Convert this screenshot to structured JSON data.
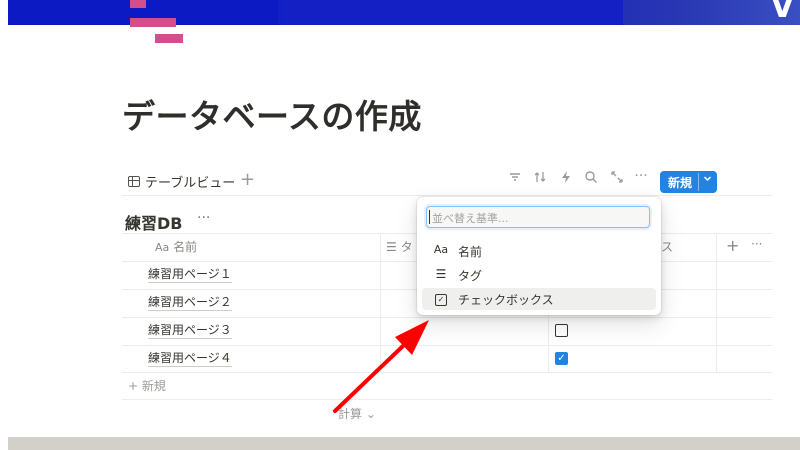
{
  "page": {
    "title": "データベースの作成"
  },
  "view": {
    "tab_label": "テーブルビュー",
    "add_view": "+"
  },
  "toolbar": {
    "new_label": "新規",
    "icons": [
      "filter-icon",
      "sort-icon",
      "lightning-icon",
      "search-icon",
      "expand-icon",
      "more-icon"
    ]
  },
  "database": {
    "title": "練習DB",
    "more": "···"
  },
  "columns": {
    "name": {
      "icon": "Aa",
      "label": "名前"
    },
    "tag": {
      "icon": "☰",
      "label": "タ"
    },
    "checkbox": {
      "label": "ス"
    },
    "add": "+",
    "more": "···"
  },
  "rows": [
    {
      "name": "練習用ページ１",
      "checked": null
    },
    {
      "name": "練習用ページ２",
      "checked": null
    },
    {
      "name": "練習用ページ３",
      "checked": false
    },
    {
      "name": "練習用ページ４",
      "checked": true
    }
  ],
  "add_row": "+ 新規",
  "calc": "計算 ⌄",
  "sort_menu": {
    "placeholder": "並べ替え基準...",
    "items": [
      {
        "icon": "Aa",
        "label": "名前"
      },
      {
        "icon": "☰",
        "label": "タグ"
      },
      {
        "icon": "☑",
        "label": "チェックボックス"
      }
    ]
  },
  "colors": {
    "accent": "#2383e2",
    "arrow": "#ff0000",
    "banner": "#1322c8",
    "pink": "#d04f8c"
  }
}
